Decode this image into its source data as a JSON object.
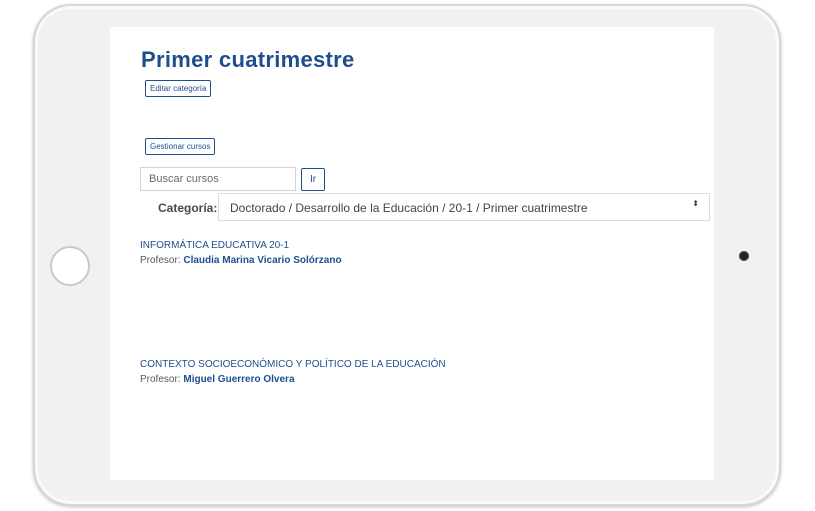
{
  "header": {
    "title": "Primer cuatrimestre",
    "edit_category_label": "Editar categoría"
  },
  "toolbar": {
    "manage_courses_label": "Gestionar cursos"
  },
  "search": {
    "placeholder": "Buscar cursos",
    "go_label": "Ir"
  },
  "category": {
    "label": "Categoría:",
    "selected": "Doctorado / Desarrollo de la Educación / 20-1 / Primer cuatrimestre",
    "arrow": "⬍"
  },
  "courses": [
    {
      "title": "INFORMÁTICA EDUCATIVA 20-1",
      "teacher_prefix": "Profesor:",
      "teacher_name": "Claudia Marina Vicario Solórzano"
    },
    {
      "title": "CONTEXTO SOCIOECONÓMICO Y POLÍTICO DE LA EDUCACIÓN",
      "teacher_prefix": "Profesor:",
      "teacher_name": "Miguel Guerrero Olvera"
    }
  ],
  "colors": {
    "accent": "#1f4e8f",
    "text": "#4a4a4a"
  }
}
